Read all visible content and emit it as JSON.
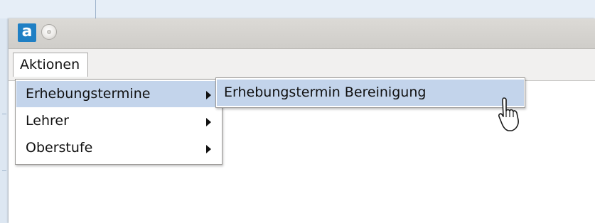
{
  "app": {
    "icon_letter": "a"
  },
  "menubar": {
    "items": [
      {
        "label": "Aktionen"
      }
    ]
  },
  "menu": {
    "items": [
      {
        "label": "Erhebungstermine",
        "has_submenu": true,
        "highlighted": true
      },
      {
        "label": "Lehrer",
        "has_submenu": true,
        "highlighted": false
      },
      {
        "label": "Oberstufe",
        "has_submenu": true,
        "highlighted": false
      }
    ]
  },
  "submenu": {
    "items": [
      {
        "label": "Erhebungstermin Bereinigung",
        "highlighted": true
      }
    ]
  },
  "colors": {
    "highlight": "#c3d4eb",
    "app_icon": "#1f7fc4",
    "titlebar": "#d6d4d0"
  },
  "icons": {
    "app": "app-icon",
    "window_button": "window-control-icon",
    "submenu_arrow": "chevron-right-icon",
    "cursor": "hand-pointer-icon"
  }
}
